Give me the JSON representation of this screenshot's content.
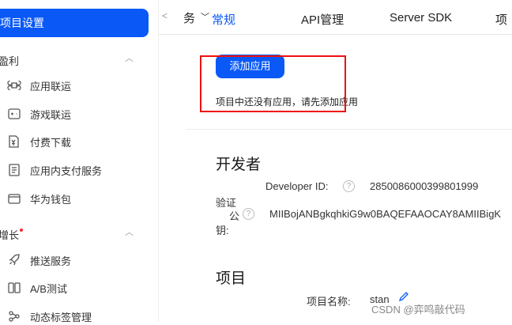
{
  "sidebar": {
    "active_label": "项目设置",
    "groups": [
      {
        "label": "盈利"
      },
      {
        "label": "增长"
      }
    ],
    "monetize_items": [
      {
        "label": "应用联运"
      },
      {
        "label": "游戏联运"
      },
      {
        "label": "付费下载"
      },
      {
        "label": "应用内支付服务"
      },
      {
        "label": "华为钱包"
      }
    ],
    "growth_items": [
      {
        "label": "推送服务"
      },
      {
        "label": "A/B测试"
      },
      {
        "label": "动态标签管理"
      }
    ]
  },
  "tabs": {
    "service_label": "务",
    "items": [
      {
        "label": "常规"
      },
      {
        "label": "API管理"
      },
      {
        "label": "Server SDK"
      },
      {
        "label": "项"
      }
    ]
  },
  "app_section": {
    "add_button": "添加应用",
    "empty_message": "项目中还没有应用，请先添加应用"
  },
  "developer": {
    "title": "开发者",
    "id_label": "Developer ID:",
    "id_value": "2850086000399801999",
    "key_label_1": "验证",
    "key_label_2": "公",
    "key_label_3": "钥:",
    "key_value": "MIIBojANBgkqhkiG9w0BAQEFAAOCAY8AMIIBigK("
  },
  "project": {
    "title": "项目",
    "name_label": "项目名称:",
    "name_value": "stan"
  },
  "watermark": "CSDN @弈鸣敲代码",
  "colors": {
    "accent": "#0a59f7",
    "annotation": "#ee1111"
  }
}
